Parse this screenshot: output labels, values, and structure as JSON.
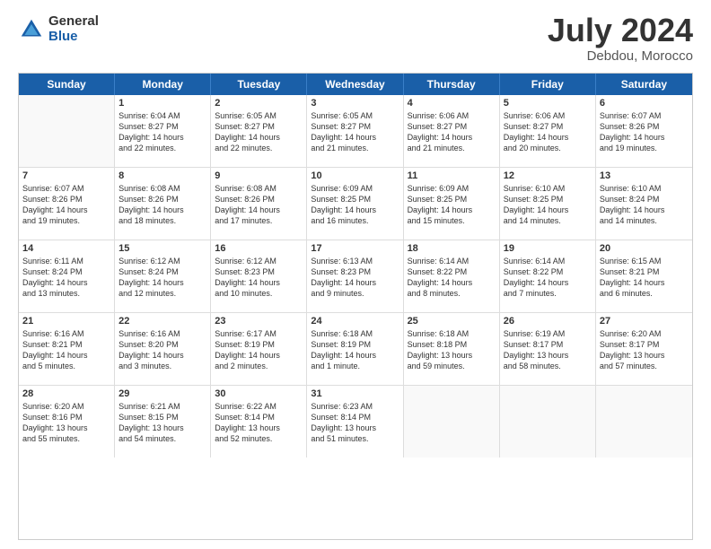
{
  "logo": {
    "general": "General",
    "blue": "Blue"
  },
  "title": "July 2024",
  "location": "Debdou, Morocco",
  "days": [
    "Sunday",
    "Monday",
    "Tuesday",
    "Wednesday",
    "Thursday",
    "Friday",
    "Saturday"
  ],
  "weeks": [
    [
      {
        "day": "",
        "info": ""
      },
      {
        "day": "1",
        "info": "Sunrise: 6:04 AM\nSunset: 8:27 PM\nDaylight: 14 hours\nand 22 minutes."
      },
      {
        "day": "2",
        "info": "Sunrise: 6:05 AM\nSunset: 8:27 PM\nDaylight: 14 hours\nand 22 minutes."
      },
      {
        "day": "3",
        "info": "Sunrise: 6:05 AM\nSunset: 8:27 PM\nDaylight: 14 hours\nand 21 minutes."
      },
      {
        "day": "4",
        "info": "Sunrise: 6:06 AM\nSunset: 8:27 PM\nDaylight: 14 hours\nand 21 minutes."
      },
      {
        "day": "5",
        "info": "Sunrise: 6:06 AM\nSunset: 8:27 PM\nDaylight: 14 hours\nand 20 minutes."
      },
      {
        "day": "6",
        "info": "Sunrise: 6:07 AM\nSunset: 8:26 PM\nDaylight: 14 hours\nand 19 minutes."
      }
    ],
    [
      {
        "day": "7",
        "info": "Sunrise: 6:07 AM\nSunset: 8:26 PM\nDaylight: 14 hours\nand 19 minutes."
      },
      {
        "day": "8",
        "info": "Sunrise: 6:08 AM\nSunset: 8:26 PM\nDaylight: 14 hours\nand 18 minutes."
      },
      {
        "day": "9",
        "info": "Sunrise: 6:08 AM\nSunset: 8:26 PM\nDaylight: 14 hours\nand 17 minutes."
      },
      {
        "day": "10",
        "info": "Sunrise: 6:09 AM\nSunset: 8:25 PM\nDaylight: 14 hours\nand 16 minutes."
      },
      {
        "day": "11",
        "info": "Sunrise: 6:09 AM\nSunset: 8:25 PM\nDaylight: 14 hours\nand 15 minutes."
      },
      {
        "day": "12",
        "info": "Sunrise: 6:10 AM\nSunset: 8:25 PM\nDaylight: 14 hours\nand 14 minutes."
      },
      {
        "day": "13",
        "info": "Sunrise: 6:10 AM\nSunset: 8:24 PM\nDaylight: 14 hours\nand 14 minutes."
      }
    ],
    [
      {
        "day": "14",
        "info": "Sunrise: 6:11 AM\nSunset: 8:24 PM\nDaylight: 14 hours\nand 13 minutes."
      },
      {
        "day": "15",
        "info": "Sunrise: 6:12 AM\nSunset: 8:24 PM\nDaylight: 14 hours\nand 12 minutes."
      },
      {
        "day": "16",
        "info": "Sunrise: 6:12 AM\nSunset: 8:23 PM\nDaylight: 14 hours\nand 10 minutes."
      },
      {
        "day": "17",
        "info": "Sunrise: 6:13 AM\nSunset: 8:23 PM\nDaylight: 14 hours\nand 9 minutes."
      },
      {
        "day": "18",
        "info": "Sunrise: 6:14 AM\nSunset: 8:22 PM\nDaylight: 14 hours\nand 8 minutes."
      },
      {
        "day": "19",
        "info": "Sunrise: 6:14 AM\nSunset: 8:22 PM\nDaylight: 14 hours\nand 7 minutes."
      },
      {
        "day": "20",
        "info": "Sunrise: 6:15 AM\nSunset: 8:21 PM\nDaylight: 14 hours\nand 6 minutes."
      }
    ],
    [
      {
        "day": "21",
        "info": "Sunrise: 6:16 AM\nSunset: 8:21 PM\nDaylight: 14 hours\nand 5 minutes."
      },
      {
        "day": "22",
        "info": "Sunrise: 6:16 AM\nSunset: 8:20 PM\nDaylight: 14 hours\nand 3 minutes."
      },
      {
        "day": "23",
        "info": "Sunrise: 6:17 AM\nSunset: 8:19 PM\nDaylight: 14 hours\nand 2 minutes."
      },
      {
        "day": "24",
        "info": "Sunrise: 6:18 AM\nSunset: 8:19 PM\nDaylight: 14 hours\nand 1 minute."
      },
      {
        "day": "25",
        "info": "Sunrise: 6:18 AM\nSunset: 8:18 PM\nDaylight: 13 hours\nand 59 minutes."
      },
      {
        "day": "26",
        "info": "Sunrise: 6:19 AM\nSunset: 8:17 PM\nDaylight: 13 hours\nand 58 minutes."
      },
      {
        "day": "27",
        "info": "Sunrise: 6:20 AM\nSunset: 8:17 PM\nDaylight: 13 hours\nand 57 minutes."
      }
    ],
    [
      {
        "day": "28",
        "info": "Sunrise: 6:20 AM\nSunset: 8:16 PM\nDaylight: 13 hours\nand 55 minutes."
      },
      {
        "day": "29",
        "info": "Sunrise: 6:21 AM\nSunset: 8:15 PM\nDaylight: 13 hours\nand 54 minutes."
      },
      {
        "day": "30",
        "info": "Sunrise: 6:22 AM\nSunset: 8:14 PM\nDaylight: 13 hours\nand 52 minutes."
      },
      {
        "day": "31",
        "info": "Sunrise: 6:23 AM\nSunset: 8:14 PM\nDaylight: 13 hours\nand 51 minutes."
      },
      {
        "day": "",
        "info": ""
      },
      {
        "day": "",
        "info": ""
      },
      {
        "day": "",
        "info": ""
      }
    ]
  ]
}
